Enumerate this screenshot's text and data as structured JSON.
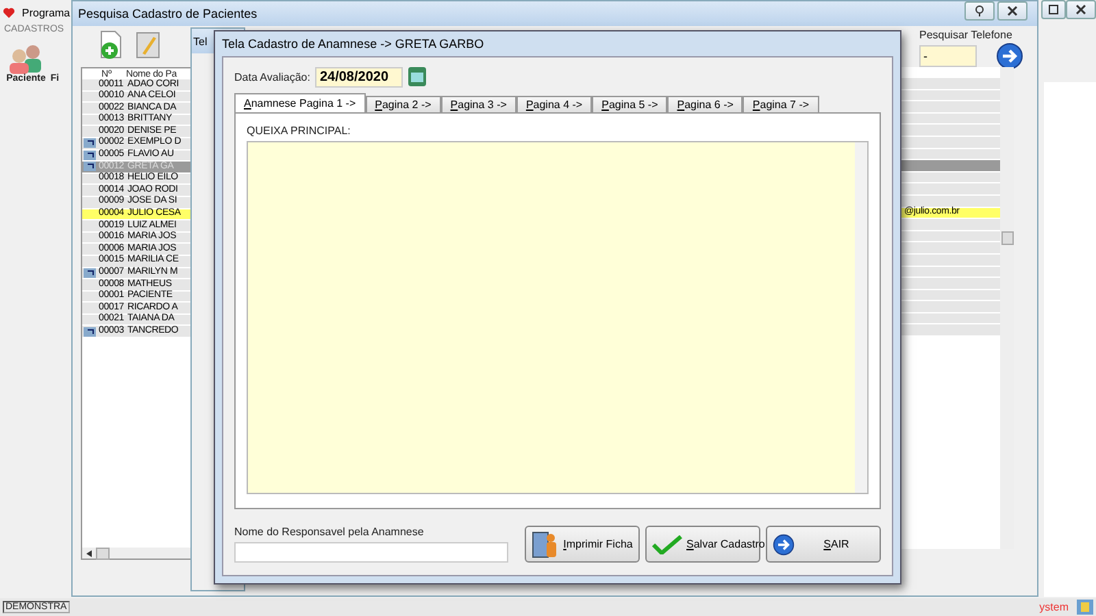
{
  "main_window": {
    "title": "Programa",
    "menu": [
      "CADASTROS"
    ],
    "toolbar": [
      {
        "label": "Paciente"
      },
      {
        "label": "Fi"
      }
    ],
    "status_bar": {
      "left": "DEMONSTRA",
      "right": "ystem"
    }
  },
  "search_window": {
    "title": "Pesquisa Cadastro de Pacientes",
    "phone_search": {
      "label": "Pesquisar Telefone",
      "value": "-"
    },
    "table": {
      "columns": [
        "Nº",
        "Nome do Pa"
      ],
      "rows": [
        {
          "number": "00011",
          "name": "ADAO CORI",
          "flag": false,
          "selected": false,
          "highlighted": false
        },
        {
          "number": "00010",
          "name": "ANA CELOI",
          "flag": false,
          "selected": false,
          "highlighted": false
        },
        {
          "number": "00022",
          "name": "BIANCA DA",
          "flag": false,
          "selected": false,
          "highlighted": false
        },
        {
          "number": "00013",
          "name": "BRITTANY",
          "flag": false,
          "selected": false,
          "highlighted": false
        },
        {
          "number": "00020",
          "name": "DENISE PE",
          "flag": false,
          "selected": false,
          "highlighted": false
        },
        {
          "number": "00002",
          "name": "EXEMPLO D",
          "flag": true,
          "selected": false,
          "highlighted": false
        },
        {
          "number": "00005",
          "name": "FLAVIO AU",
          "flag": true,
          "selected": false,
          "highlighted": false
        },
        {
          "number": "00012",
          "name": "GRETA GA",
          "flag": true,
          "selected": true,
          "highlighted": false
        },
        {
          "number": "00018",
          "name": "HELIO EILO",
          "flag": false,
          "selected": false,
          "highlighted": false
        },
        {
          "number": "00014",
          "name": "JOAO RODI",
          "flag": false,
          "selected": false,
          "highlighted": false
        },
        {
          "number": "00009",
          "name": "JOSE DA SI",
          "flag": false,
          "selected": false,
          "highlighted": false
        },
        {
          "number": "00004",
          "name": "JULIO CESA",
          "flag": false,
          "selected": false,
          "highlighted": true,
          "email": "@julio.com.br"
        },
        {
          "number": "00019",
          "name": "LUIZ ALMEI",
          "flag": false,
          "selected": false,
          "highlighted": false
        },
        {
          "number": "00016",
          "name": "MARIA JOS",
          "flag": false,
          "selected": false,
          "highlighted": false
        },
        {
          "number": "00006",
          "name": "MARIA JOS",
          "flag": false,
          "selected": false,
          "highlighted": false
        },
        {
          "number": "00015",
          "name": "MARILIA CE",
          "flag": false,
          "selected": false,
          "highlighted": false
        },
        {
          "number": "00007",
          "name": "MARILYN M",
          "flag": true,
          "selected": false,
          "highlighted": false
        },
        {
          "number": "00008",
          "name": "MATHEUS",
          "flag": false,
          "selected": false,
          "highlighted": false
        },
        {
          "number": "00001",
          "name": "PACIENTE",
          "flag": false,
          "selected": false,
          "highlighted": false
        },
        {
          "number": "00017",
          "name": "RICARDO A",
          "flag": false,
          "selected": false,
          "highlighted": false
        },
        {
          "number": "00021",
          "name": "TAIANA DA",
          "flag": false,
          "selected": false,
          "highlighted": false
        },
        {
          "number": "00003",
          "name": "TANCREDO",
          "flag": true,
          "selected": false,
          "highlighted": false
        }
      ]
    }
  },
  "back_window": {
    "title": "Tel"
  },
  "anamnese_window": {
    "title": "Tela Cadastro de Anamnese -> GRETA GARBO",
    "date": {
      "label": "Data Avaliação:",
      "value": "24/08/2020"
    },
    "tabs": [
      {
        "label": "Anamnese Pagina 1 ->",
        "selected": true
      },
      {
        "label": "Pagina 2 ->",
        "selected": false
      },
      {
        "label": "Pagina 3 ->",
        "selected": false
      },
      {
        "label": "Pagina 4 ->",
        "selected": false
      },
      {
        "label": "Pagina 5 ->",
        "selected": false
      },
      {
        "label": "Pagina 6 ->",
        "selected": false
      },
      {
        "label": "Pagina 7 ->",
        "selected": false
      }
    ],
    "section_label": "QUEIXA PRINCIPAL:",
    "responsible": {
      "label": "Nome do Responsavel pela Anamnese"
    },
    "buttons": [
      {
        "kind": "print",
        "label": "Imprimir Ficha"
      },
      {
        "kind": "save",
        "label": "Salvar Cadastro"
      },
      {
        "kind": "exit",
        "label": "SAIR"
      }
    ]
  }
}
